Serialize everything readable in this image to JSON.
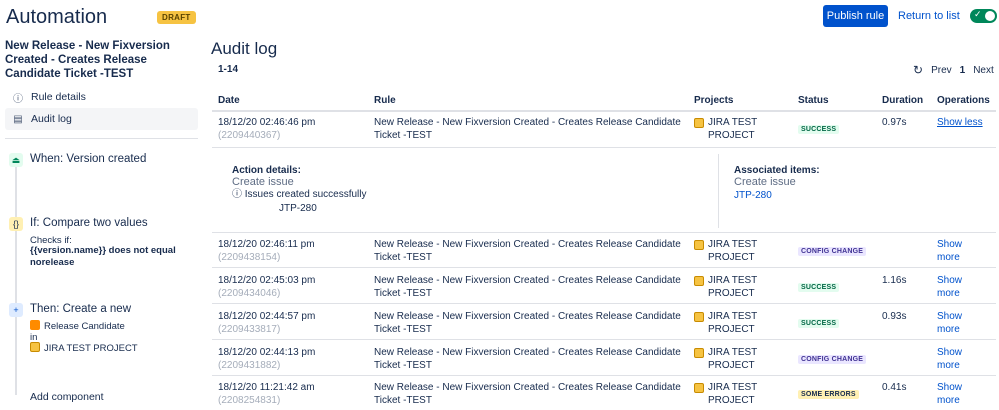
{
  "header": {
    "title": "Automation",
    "draft_badge": "DRAFT",
    "publish_label": "Publish rule",
    "return_label": "Return to list",
    "toggle_on": true
  },
  "sidebar": {
    "rule_name": "New Release - New Fixversion Created - Creates Release Candidate Ticket -TEST",
    "items": [
      {
        "label": "Rule details",
        "icon": "info-icon"
      },
      {
        "label": "Audit log",
        "icon": "document-icon",
        "active": true
      }
    ],
    "steps": {
      "trigger": {
        "title": "When: Version created"
      },
      "condition": {
        "title": "If: Compare two values",
        "checks_label": "Checks if:",
        "expr": "{{version.name}} does not equal norelease"
      },
      "action": {
        "title": "Then: Create a new",
        "issue_type": "Release Candidate",
        "in_label": "in",
        "project": "JIRA TEST PROJECT"
      }
    },
    "add_component": "Add component"
  },
  "main": {
    "title": "Audit log",
    "range": "1-14",
    "pager": {
      "prev": "Prev",
      "page": "1",
      "next": "Next"
    },
    "columns": [
      "Date",
      "Rule",
      "Projects",
      "Status",
      "Duration",
      "Operations"
    ],
    "rows": [
      {
        "date": "18/12/20 02:46:46 pm",
        "id": "(2209440367)",
        "rule1": "New Release - New Fixversion Created - Creates Release Candidate",
        "rule2": "Ticket -TEST",
        "proj1": "JIRA TEST",
        "proj2": "PROJECT",
        "status": "SUCCESS",
        "duration": "0.97s",
        "op1": "Show less",
        "op2": ""
      },
      {
        "date": "18/12/20 02:46:11 pm",
        "id": "(2209438154)",
        "rule1": "New Release - New Fixversion Created - Creates Release Candidate",
        "rule2": "Ticket -TEST",
        "proj1": "JIRA TEST",
        "proj2": "PROJECT",
        "status": "CONFIG CHANGE",
        "duration": "",
        "op1": "Show",
        "op2": "more"
      },
      {
        "date": "18/12/20 02:45:03 pm",
        "id": "(2209434046)",
        "rule1": "New Release - New Fixversion Created - Creates Release Candidate",
        "rule2": "Ticket -TEST",
        "proj1": "JIRA TEST",
        "proj2": "PROJECT",
        "status": "SUCCESS",
        "duration": "1.16s",
        "op1": "Show",
        "op2": "more"
      },
      {
        "date": "18/12/20 02:44:57 pm",
        "id": "(2209433817)",
        "rule1": "New Release - New Fixversion Created - Creates Release Candidate",
        "rule2": "Ticket -TEST",
        "proj1": "JIRA TEST",
        "proj2": "PROJECT",
        "status": "SUCCESS",
        "duration": "0.93s",
        "op1": "Show",
        "op2": "more"
      },
      {
        "date": "18/12/20 02:44:13 pm",
        "id": "(2209431882)",
        "rule1": "New Release - New Fixversion Created - Creates Release Candidate",
        "rule2": "Ticket -TEST",
        "proj1": "JIRA TEST",
        "proj2": "PROJECT",
        "status": "CONFIG CHANGE",
        "duration": "",
        "op1": "Show",
        "op2": "more"
      },
      {
        "date": "18/12/20 11:21:42 am",
        "id": "(2208254831)",
        "rule1": "New Release - New Fixversion Created - Creates Release Candidate",
        "rule2": "Ticket -TEST",
        "proj1": "JIRA TEST",
        "proj2": "PROJECT",
        "status": "SOME ERRORS",
        "duration": "0.41s",
        "op1": "Show",
        "op2": "more"
      }
    ],
    "details": {
      "action_label": "Action details:",
      "action_value": "Create issue",
      "action_msg": "Issues created successfully",
      "action_key": "JTP-280",
      "assoc_label": "Associated items:",
      "assoc_value": "Create issue",
      "assoc_key": "JTP-280"
    }
  },
  "colors": {
    "primary": "#0052CC",
    "toggle": "#00875A",
    "draft": "#F6C342"
  }
}
